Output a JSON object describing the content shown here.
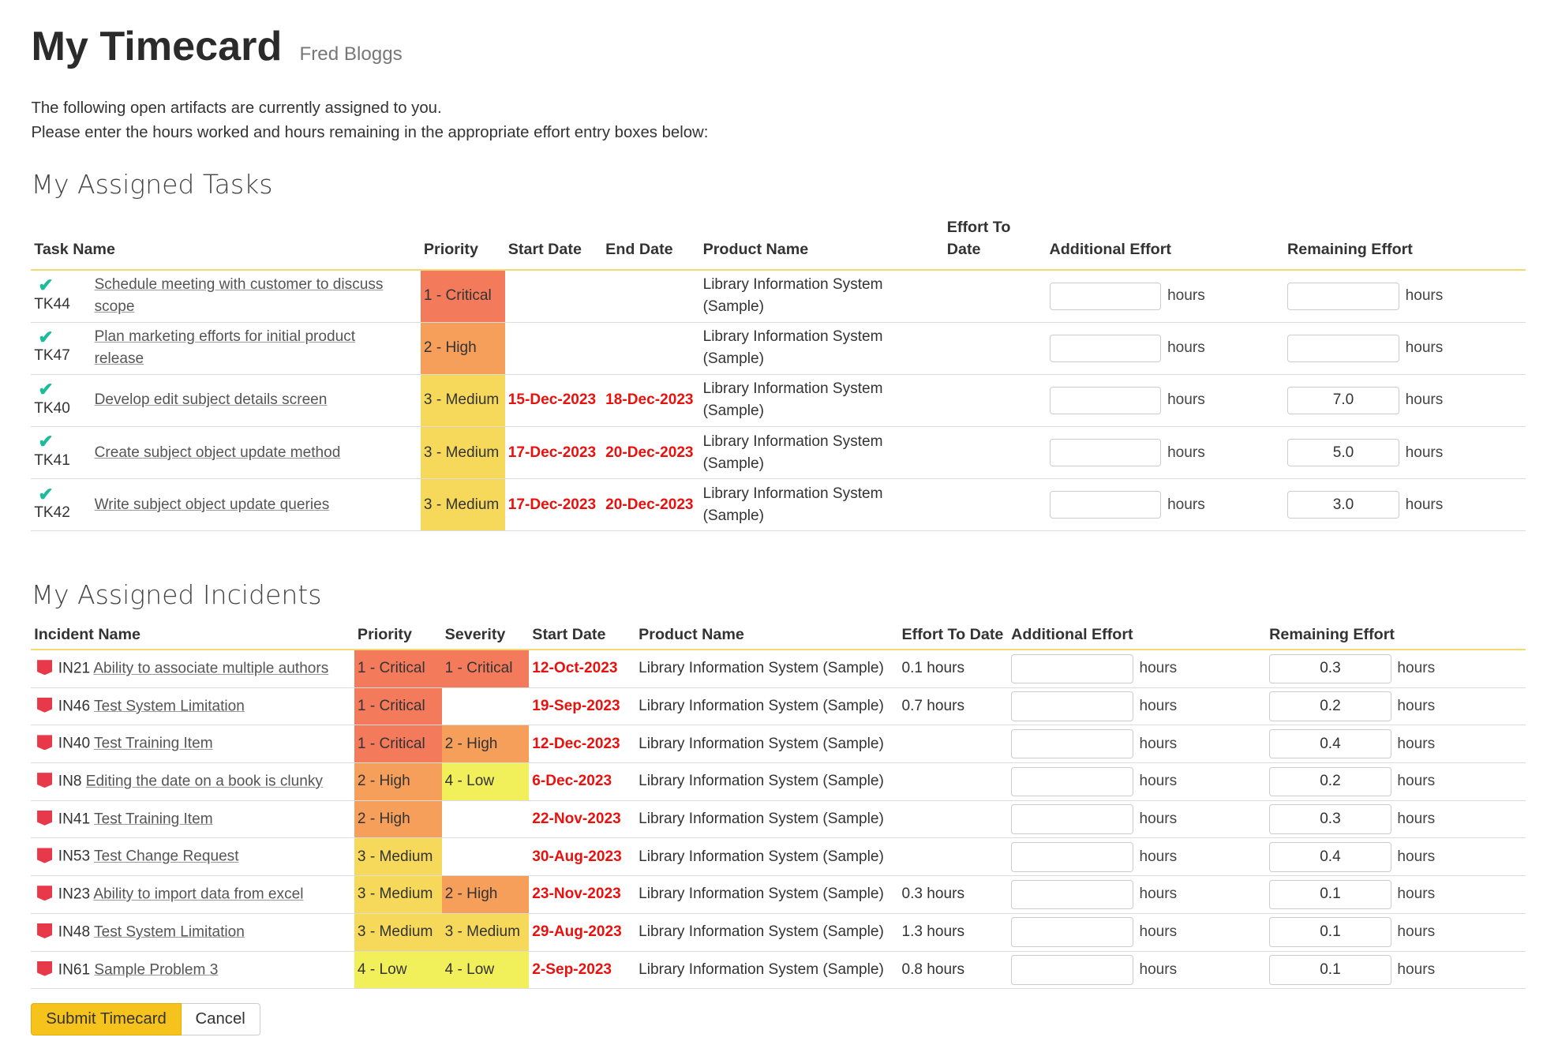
{
  "header": {
    "title": "My Timecard",
    "user": "Fred Bloggs",
    "intro_line1": "The following open artifacts are currently assigned to you.",
    "intro_line2": "Please enter the hours worked and hours remaining in the appropriate effort entry boxes below:"
  },
  "tasks": {
    "heading": "My Assigned Tasks",
    "columns": {
      "name": "Task Name",
      "priority": "Priority",
      "start": "Start Date",
      "end": "End Date",
      "product": "Product Name",
      "effort_to_date": "Effort To Date",
      "additional": "Additional Effort",
      "remaining": "Remaining Effort"
    },
    "unit": "hours",
    "rows": [
      {
        "id": "TK44",
        "name": "Schedule meeting with customer to discuss scope",
        "priority": "1 - Critical",
        "start": "",
        "end": "",
        "product": "Library Information System (Sample)",
        "effort_to_date": "",
        "additional": "",
        "remaining": ""
      },
      {
        "id": "TK47",
        "name": "Plan marketing efforts for initial product release",
        "priority": "2 - High",
        "start": "",
        "end": "",
        "product": "Library Information System (Sample)",
        "effort_to_date": "",
        "additional": "",
        "remaining": ""
      },
      {
        "id": "TK40",
        "name": "Develop edit subject details screen",
        "priority": "3 - Medium",
        "start": "15-Dec-2023",
        "end": "18-Dec-2023",
        "product": "Library Information System (Sample)",
        "effort_to_date": "",
        "additional": "",
        "remaining": "7.0"
      },
      {
        "id": "TK41",
        "name": "Create subject object update method",
        "priority": "3 - Medium",
        "start": "17-Dec-2023",
        "end": "20-Dec-2023",
        "product": "Library Information System (Sample)",
        "effort_to_date": "",
        "additional": "",
        "remaining": "5.0"
      },
      {
        "id": "TK42",
        "name": "Write subject object update queries",
        "priority": "3 - Medium",
        "start": "17-Dec-2023",
        "end": "20-Dec-2023",
        "product": "Library Information System (Sample)",
        "effort_to_date": "",
        "additional": "",
        "remaining": "3.0"
      }
    ]
  },
  "incidents": {
    "heading": "My Assigned Incidents",
    "columns": {
      "name": "Incident Name",
      "priority": "Priority",
      "severity": "Severity",
      "start": "Start Date",
      "product": "Product Name",
      "effort_to_date": "Effort To Date",
      "additional": "Additional Effort",
      "remaining": "Remaining Effort"
    },
    "unit": "hours",
    "rows": [
      {
        "id": "IN21",
        "name": "Ability to associate multiple authors",
        "priority": "1 - Critical",
        "severity": "1 - Critical",
        "start": "12-Oct-2023",
        "product": "Library Information System (Sample)",
        "effort_to_date": "0.1 hours",
        "additional": "",
        "remaining": "0.3"
      },
      {
        "id": "IN46",
        "name": "Test System Limitation",
        "priority": "1 - Critical",
        "severity": "",
        "start": "19-Sep-2023",
        "product": "Library Information System (Sample)",
        "effort_to_date": "0.7 hours",
        "additional": "",
        "remaining": "0.2"
      },
      {
        "id": "IN40",
        "name": "Test Training Item",
        "priority": "1 - Critical",
        "severity": "2 - High",
        "start": "12-Dec-2023",
        "product": "Library Information System (Sample)",
        "effort_to_date": "",
        "additional": "",
        "remaining": "0.4"
      },
      {
        "id": "IN8",
        "name": "Editing the date on a book is clunky",
        "priority": "2 - High",
        "severity": "4 - Low",
        "start": "6-Dec-2023",
        "product": "Library Information System (Sample)",
        "effort_to_date": "",
        "additional": "",
        "remaining": "0.2"
      },
      {
        "id": "IN41",
        "name": "Test Training Item",
        "priority": "2 - High",
        "severity": "",
        "start": "22-Nov-2023",
        "product": "Library Information System (Sample)",
        "effort_to_date": "",
        "additional": "",
        "remaining": "0.3"
      },
      {
        "id": "IN53",
        "name": "Test Change Request",
        "priority": "3 - Medium",
        "severity": "",
        "start": "30-Aug-2023",
        "product": "Library Information System (Sample)",
        "effort_to_date": "",
        "additional": "",
        "remaining": "0.4"
      },
      {
        "id": "IN23",
        "name": "Ability to import data from excel",
        "priority": "3 - Medium",
        "severity": "2 - High",
        "start": "23-Nov-2023",
        "product": "Library Information System (Sample)",
        "effort_to_date": "0.3 hours",
        "additional": "",
        "remaining": "0.1"
      },
      {
        "id": "IN48",
        "name": "Test System Limitation",
        "priority": "3 - Medium",
        "severity": "3 - Medium",
        "start": "29-Aug-2023",
        "product": "Library Information System (Sample)",
        "effort_to_date": "1.3 hours",
        "additional": "",
        "remaining": "0.1"
      },
      {
        "id": "IN61",
        "name": "Sample Problem 3",
        "priority": "4 - Low",
        "severity": "4 - Low",
        "start": "2-Sep-2023",
        "product": "Library Information System (Sample)",
        "effort_to_date": "0.8 hours",
        "additional": "",
        "remaining": "0.1"
      }
    ]
  },
  "buttons": {
    "submit": "Submit Timecard",
    "cancel": "Cancel"
  },
  "colors": {
    "critical": "#f47a5c",
    "high": "#f59f5a",
    "medium": "#f6d95a",
    "low": "#f2f05a",
    "date_overdue": "#e8110e",
    "task_check": "#1bbc9b",
    "incident_icon": "#e8394a",
    "submit_button": "#f6c31c"
  }
}
